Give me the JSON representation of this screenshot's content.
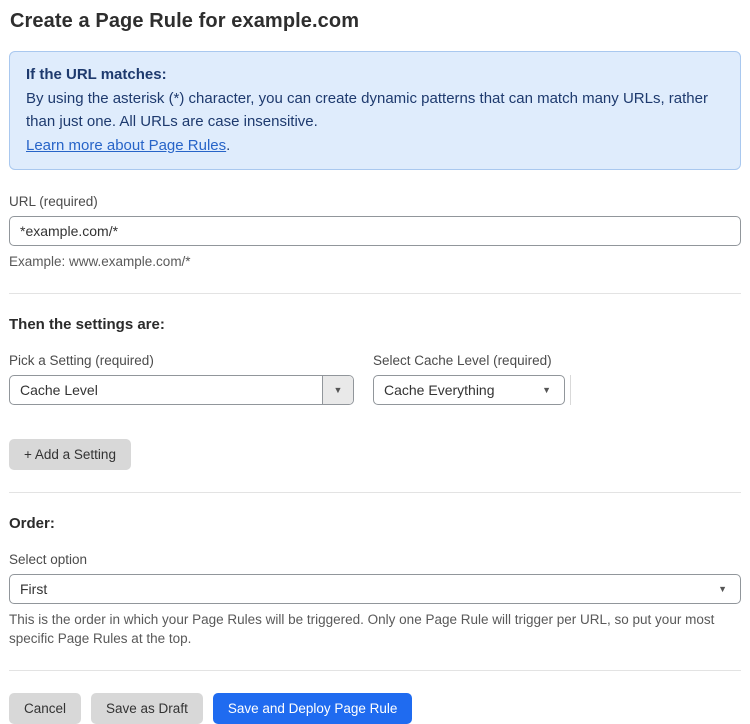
{
  "page": {
    "title": "Create a Page Rule for example.com"
  },
  "info_box": {
    "heading": "If the URL matches:",
    "body": "By using the asterisk (*) character, you can create dynamic patterns that can match many URLs, rather than just one. All URLs are case insensitive.",
    "link_label": "Learn more about Page Rules",
    "link_suffix": "."
  },
  "url_field": {
    "label": "URL (required)",
    "value": "*example.com/*",
    "hint": "Example: www.example.com/*"
  },
  "settings_section": {
    "heading": "Then the settings are:",
    "setting_picker": {
      "label": "Pick a Setting (required)",
      "value": "Cache Level"
    },
    "cache_level_picker": {
      "label": "Select Cache Level (required)",
      "value": "Cache Everything"
    },
    "add_setting_label": "+ Add a Setting"
  },
  "order_section": {
    "heading": "Order:",
    "label": "Select option",
    "value": "First",
    "hint": "This is the order in which your Page Rules will be triggered. Only one Page Rule will trigger per URL, so put your most specific Page Rules at the top."
  },
  "actions": {
    "cancel_label": "Cancel",
    "save_draft_label": "Save as Draft",
    "save_deploy_label": "Save and Deploy Page Rule"
  },
  "icons": {
    "caret_down": "▼"
  },
  "colors": {
    "accent_blue": "#1f6bf0",
    "info_background": "#dfecfc",
    "info_border": "#a9c8ef",
    "info_text": "#1e3a6e",
    "link_blue": "#2764c8",
    "button_gray": "#d8d8d8",
    "border_gray": "#91969b"
  }
}
